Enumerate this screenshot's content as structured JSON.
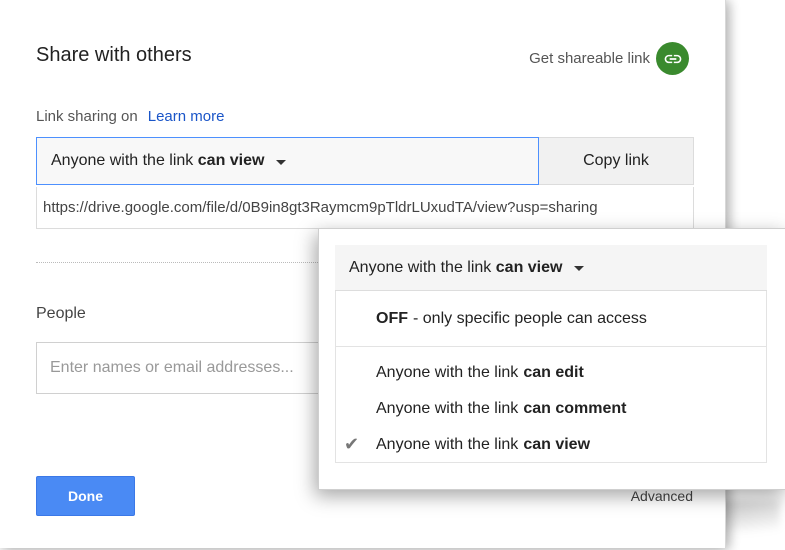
{
  "dialog": {
    "title": "Share with others",
    "get_link_label": "Get shareable link",
    "link_status": "Link sharing on",
    "learn_more": "Learn more",
    "access": {
      "prefix": "Anyone with the link",
      "level": "can view"
    },
    "copy_link": "Copy link",
    "url": "https://drive.google.com/file/d/0B9in8gt3Raymcm9pTldrLUxudTA/view?usp=sharing",
    "people_label": "People",
    "people_placeholder": "Enter names or email addresses...",
    "done": "Done",
    "advanced": "Advanced"
  },
  "popup": {
    "header_prefix": "Anyone with the link",
    "header_level": "can view",
    "options": [
      {
        "bold": "OFF",
        "text": " - only specific people can access"
      },
      {
        "prefix": "Anyone with the link",
        "bold": "can edit"
      },
      {
        "prefix": "Anyone with the link",
        "bold": "can comment"
      },
      {
        "prefix": "Anyone with the link",
        "bold": "can view",
        "selected": true
      }
    ]
  },
  "colors": {
    "link_icon_bg": "#3a8a2e",
    "done_bg": "#4a8af4",
    "learn_more": "#1a55c8",
    "select_border": "#4d90fe"
  }
}
